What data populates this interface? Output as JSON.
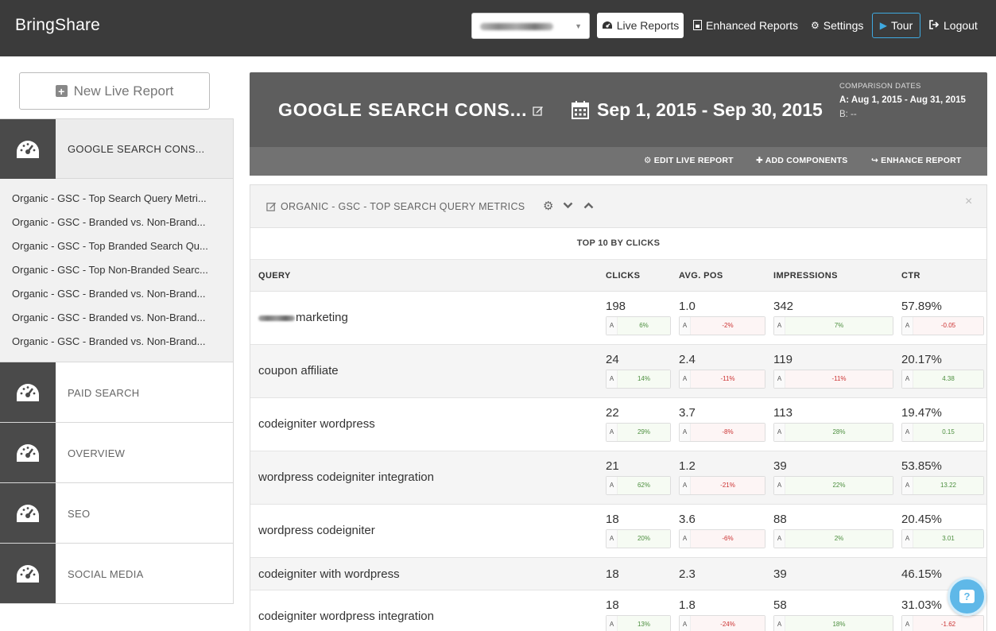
{
  "app": {
    "brand": "BringShare"
  },
  "topnav": {
    "live_reports": "Live Reports",
    "enhanced_reports": "Enhanced Reports",
    "settings": "Settings",
    "tour": "Tour",
    "logout": "Logout"
  },
  "sidebar": {
    "new_report_label": "New Live Report",
    "active_section": {
      "label": "GOOGLE SEARCH CONS...",
      "items": [
        "Organic - GSC - Top Search Query Metri...",
        "Organic - GSC - Branded vs. Non-Brand...",
        "Organic - GSC - Top Branded Search Qu...",
        "Organic - GSC - Top Non-Branded Searc...",
        "Organic - GSC - Branded vs. Non-Brand...",
        "Organic - GSC - Branded vs. Non-Brand...",
        "Organic - GSC - Branded vs. Non-Brand..."
      ]
    },
    "sections": [
      "PAID SEARCH",
      "OVERVIEW",
      "SEO",
      "SOCIAL MEDIA"
    ]
  },
  "report": {
    "title": "GOOGLE SEARCH CONS...",
    "date_range": "Sep 1, 2015 - Sep 30, 2015",
    "comparison_label": "COMPARISON DATES",
    "comparison_a": "A: Aug 1, 2015 - Aug 31, 2015",
    "comparison_b": "B: --",
    "actions": {
      "edit": "EDIT LIVE REPORT",
      "add": "ADD COMPONENTS",
      "enhance": "ENHANCE REPORT"
    }
  },
  "component": {
    "title": "ORGANIC - GSC - TOP SEARCH QUERY METRICS",
    "subtitle": "TOP 10 BY CLICKS",
    "columns": [
      "QUERY",
      "CLICKS",
      "AVG. POS",
      "IMPRESSIONS",
      "CTR"
    ],
    "chip_label": "A",
    "rows": [
      {
        "query": "marketing",
        "clicks": "198",
        "clicks_chg": "6%",
        "avgpos": "1.0",
        "avgpos_chg": "-2%",
        "impr": "342",
        "impr_chg": "7%",
        "ctr": "57.89%",
        "ctr_chg": "-0.05"
      },
      {
        "query": "coupon affiliate",
        "clicks": "24",
        "clicks_chg": "14%",
        "avgpos": "2.4",
        "avgpos_chg": "-11%",
        "impr": "119",
        "impr_chg": "-11%",
        "ctr": "20.17%",
        "ctr_chg": "4.38"
      },
      {
        "query": "codeigniter wordpress",
        "clicks": "22",
        "clicks_chg": "29%",
        "avgpos": "3.7",
        "avgpos_chg": "-8%",
        "impr": "113",
        "impr_chg": "28%",
        "ctr": "19.47%",
        "ctr_chg": "0.15"
      },
      {
        "query": "wordpress codeigniter integration",
        "clicks": "21",
        "clicks_chg": "62%",
        "avgpos": "1.2",
        "avgpos_chg": "-21%",
        "impr": "39",
        "impr_chg": "22%",
        "ctr": "53.85%",
        "ctr_chg": "13.22"
      },
      {
        "query": "wordpress codeigniter",
        "clicks": "18",
        "clicks_chg": "20%",
        "avgpos": "3.6",
        "avgpos_chg": "-6%",
        "impr": "88",
        "impr_chg": "2%",
        "ctr": "20.45%",
        "ctr_chg": "3.01"
      },
      {
        "query": "codeigniter with wordpress",
        "clicks": "18",
        "avgpos": "2.3",
        "impr": "39",
        "ctr": "46.15%"
      },
      {
        "query": "codeigniter wordpress integration",
        "clicks": "18",
        "clicks_chg": "13%",
        "avgpos": "1.8",
        "avgpos_chg": "-24%",
        "impr": "58",
        "impr_chg": "18%",
        "ctr": "31.03%",
        "ctr_chg": "-1.62"
      }
    ]
  },
  "colors": {
    "topbar": "#3b3b3b",
    "accent": "#3fa9e0",
    "positive": "#4d8f3f",
    "negative": "#cc3333"
  },
  "icons": [
    "dashboard-icon",
    "calendar-icon",
    "edit-icon",
    "gear-icon",
    "chevron-down-icon",
    "chevron-up-icon",
    "close-icon",
    "play-icon",
    "logout-icon",
    "help-chat-icon"
  ]
}
